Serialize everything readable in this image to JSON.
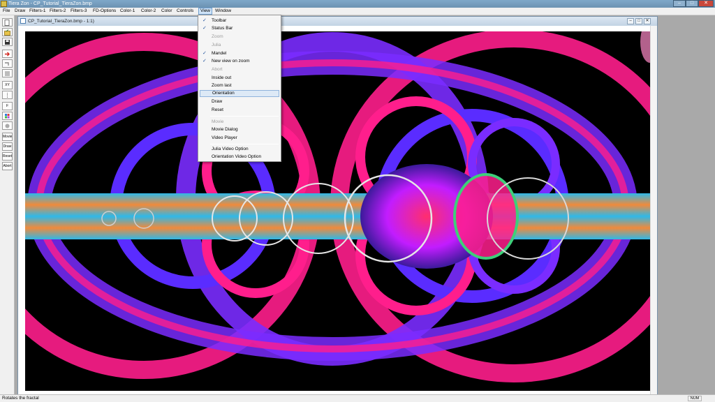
{
  "app": {
    "title": "Tiera Zon - CP_Tutorial_TieraZon.bmp",
    "controls": {
      "minimize": "–",
      "maximize": "□",
      "close": "✕"
    }
  },
  "menubar": {
    "items": [
      "File",
      "Draw",
      "Filters-1",
      "Filters-2",
      "Filters-3",
      "FD-Options",
      "Color-1",
      "Color-2",
      "Color",
      "Controls",
      "View",
      "Window"
    ],
    "active": "View"
  },
  "toolbar": {
    "buttons": [
      {
        "name": "new-icon",
        "label": ""
      },
      {
        "name": "open-icon",
        "label": ""
      },
      {
        "name": "save-icon",
        "label": ""
      },
      {
        "name": "arrow-icon",
        "label": ""
      },
      {
        "name": "undo-icon",
        "label": ""
      },
      {
        "name": "stop-icon",
        "label": ""
      },
      {
        "name": "xy-icon",
        "label": "XY"
      },
      {
        "name": "zoom-icon",
        "label": ""
      },
      {
        "name": "f-icon",
        "label": "F"
      },
      {
        "name": "palette-icon",
        "label": ""
      },
      {
        "name": "dot-icon",
        "label": ""
      },
      {
        "name": "movie-button",
        "label": "Movie"
      },
      {
        "name": "draw-button",
        "label": "Draw"
      },
      {
        "name": "reset-button",
        "label": "Reset"
      },
      {
        "name": "abort-button",
        "label": "Abort"
      }
    ]
  },
  "document": {
    "title": "CP_Tutorial_TieraZon.bmp - 1:1)",
    "controls": {
      "minimize": "–",
      "maximize": "□",
      "close": "✕"
    }
  },
  "view_menu": {
    "items": [
      {
        "label": "Toolbar",
        "checked": true,
        "disabled": false
      },
      {
        "label": "Status Bar",
        "checked": true,
        "disabled": false
      },
      {
        "label": "Zoom",
        "checked": false,
        "disabled": true
      },
      {
        "label": "Julia",
        "checked": false,
        "disabled": true
      },
      {
        "label": "Mandel",
        "checked": true,
        "disabled": false
      },
      {
        "label": "New view on zoom",
        "checked": true,
        "disabled": false
      },
      {
        "label": "Abort",
        "checked": false,
        "disabled": true
      },
      {
        "label": "Inside out",
        "checked": false,
        "disabled": false
      },
      {
        "label": "Zoom last",
        "checked": false,
        "disabled": false
      },
      {
        "label": "Orientation",
        "checked": false,
        "disabled": false,
        "highlighted": true
      },
      {
        "label": "Draw",
        "checked": false,
        "disabled": false
      },
      {
        "label": "Reset",
        "checked": false,
        "disabled": false
      },
      {
        "separator": true
      },
      {
        "label": "Movie",
        "checked": false,
        "disabled": true
      },
      {
        "label": "Movie Dialog",
        "checked": false,
        "disabled": false
      },
      {
        "label": "Video Player",
        "checked": false,
        "disabled": false
      },
      {
        "separator": true
      },
      {
        "label": "Julia Video Option",
        "checked": false,
        "disabled": false
      },
      {
        "label": "Orientation Video Option",
        "checked": false,
        "disabled": false
      }
    ],
    "check_mark": "✓"
  },
  "statusbar": {
    "message": "Rotates the fractal",
    "indicator": "NUM"
  },
  "colors": {
    "magenta": "#ff1e8c",
    "violet": "#7a2cff",
    "cyan": "#2fb8e8",
    "orange": "#f08a3c",
    "green": "#3ecf7a"
  }
}
